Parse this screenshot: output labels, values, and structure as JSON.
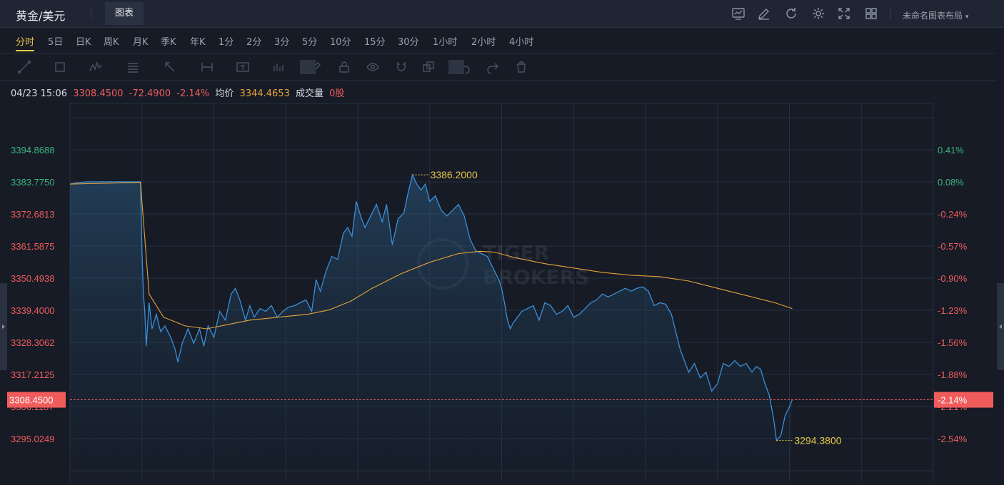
{
  "header": {
    "symbol": "黄金/美元",
    "tab_chart": "图表",
    "layout_name": "未命名图表布局",
    "icons": [
      "chart-type-icon",
      "draw-icon",
      "refresh-icon",
      "settings-icon",
      "fullscreen-icon",
      "layout-grid-icon"
    ]
  },
  "periods": [
    "分时",
    "5日",
    "日K",
    "周K",
    "月K",
    "季K",
    "年K",
    "1分",
    "2分",
    "3分",
    "5分",
    "10分",
    "15分",
    "30分",
    "1小时",
    "2小时",
    "4小时"
  ],
  "active_period": "分时",
  "toolbar": {
    "icons": [
      "line-tool-icon",
      "rect-tool-icon",
      "pattern-tool-icon",
      "fib-tool-icon",
      "arrow-tool-icon",
      "measure-tool-icon",
      "text-tool-icon",
      "volume-tool-icon",
      "pen-icon",
      "lock-icon",
      "eye-icon",
      "magnet-icon",
      "clone-icon",
      "undo-icon",
      "redo-icon",
      "trash-icon"
    ]
  },
  "info": {
    "datetime": "04/23 15:06",
    "price": "3308.4500",
    "change": "-72.4900",
    "change_pct": "-2.14%",
    "avg_label": "均价",
    "avg_value": "3344.4653",
    "volume_label": "成交量",
    "volume_value": "0股"
  },
  "colors": {
    "up": "#3fb37f",
    "down": "#f05c5c",
    "price_line": "#3a8fd9",
    "avg_line": "#e8a23a",
    "highlight": "#e8c547",
    "grid": "#273040",
    "badge_bg": "#f05c5c"
  },
  "chart_data": {
    "type": "line",
    "y_left_ticks": [
      "3394.8688",
      "3383.7750",
      "3372.6813",
      "3361.5875",
      "3350.4938",
      "3339.4000",
      "3328.3062",
      "3317.2125",
      "3306.1187",
      "3295.0249"
    ],
    "y_right_ticks": [
      "0.41%",
      "0.08%",
      "-0.24%",
      "-0.57%",
      "-0.90%",
      "-1.23%",
      "-1.56%",
      "-1.88%",
      "-2.21%",
      "-2.54%"
    ],
    "ylim": [
      3286.7,
      3397.1
    ],
    "prev_close": 3380.94,
    "current_price": 3308.45,
    "current_price_label": "3308.4500",
    "current_pct_label": "-2.14%",
    "high": 3386.2,
    "high_label": "3386.2000",
    "low": 3294.38,
    "low_label": "3294.3800",
    "x_range": [
      0,
      300
    ],
    "price_series": [
      [
        0,
        3383.0
      ],
      [
        5,
        3383.5
      ],
      [
        12,
        3383.8
      ],
      [
        25,
        3383.8
      ],
      [
        49,
        3383.8
      ],
      [
        50,
        3360.0
      ],
      [
        51,
        3345.0
      ],
      [
        52,
        3339.0
      ],
      [
        53,
        3327.0
      ],
      [
        55,
        3342.0
      ],
      [
        57,
        3333.0
      ],
      [
        60,
        3338.0
      ],
      [
        63,
        3332.0
      ],
      [
        66,
        3334.0
      ],
      [
        70,
        3330.0
      ],
      [
        73,
        3326.0
      ],
      [
        75,
        3321.5
      ],
      [
        78,
        3328.0
      ],
      [
        82,
        3333.0
      ],
      [
        86,
        3328.0
      ],
      [
        90,
        3333.0
      ],
      [
        93,
        3327.0
      ],
      [
        96,
        3334.0
      ],
      [
        100,
        3330.0
      ],
      [
        104,
        3339.0
      ],
      [
        108,
        3336.0
      ],
      [
        112,
        3345.0
      ],
      [
        115,
        3347.0
      ],
      [
        118,
        3343.0
      ],
      [
        122,
        3336.0
      ],
      [
        125,
        3341.0
      ],
      [
        128,
        3337.0
      ],
      [
        132,
        3340.0
      ],
      [
        136,
        3339.0
      ],
      [
        140,
        3341.0
      ],
      [
        144,
        3337.0
      ],
      [
        148,
        3339.0
      ],
      [
        152,
        3340.5
      ],
      [
        156,
        3341.0
      ],
      [
        160,
        3342.0
      ],
      [
        164,
        3343.0
      ],
      [
        168,
        3339.0
      ],
      [
        171,
        3350.0
      ],
      [
        174,
        3346.0
      ],
      [
        178,
        3353.0
      ],
      [
        182,
        3358.0
      ],
      [
        186,
        3357.0
      ],
      [
        190,
        3366.0
      ],
      [
        193,
        3368.0
      ],
      [
        196,
        3365.0
      ],
      [
        199,
        3377.0
      ],
      [
        202,
        3372.0
      ],
      [
        205,
        3368.0
      ],
      [
        209,
        3372.0
      ],
      [
        213,
        3376.0
      ],
      [
        217,
        3370.0
      ],
      [
        220,
        3376.0
      ],
      [
        224,
        3362.0
      ],
      [
        228,
        3371.0
      ],
      [
        232,
        3373.0
      ],
      [
        235,
        3380.0
      ],
      [
        238,
        3386.2
      ],
      [
        241,
        3383.0
      ],
      [
        244,
        3381.0
      ],
      [
        247,
        3383.0
      ],
      [
        250,
        3377.0
      ],
      [
        254,
        3379.0
      ],
      [
        258,
        3374.0
      ],
      [
        262,
        3372.0
      ],
      [
        266,
        3374.0
      ],
      [
        270,
        3376.0
      ],
      [
        274,
        3372.0
      ],
      [
        278,
        3364.0
      ],
      [
        282,
        3360.0
      ],
      [
        286,
        3359.0
      ],
      [
        290,
        3358.0
      ],
      [
        294,
        3354.0
      ],
      [
        298,
        3350.0
      ]
    ],
    "price_series_b": [
      [
        300,
        3347.0
      ],
      [
        302,
        3342.0
      ],
      [
        304,
        3336.0
      ],
      [
        306,
        3333.0
      ],
      [
        308,
        3335.0
      ],
      [
        311,
        3337.0
      ],
      [
        314,
        3339.0
      ],
      [
        318,
        3340.0
      ],
      [
        322,
        3341.0
      ],
      [
        326,
        3336.0
      ],
      [
        330,
        3342.0
      ],
      [
        334,
        3341.0
      ],
      [
        338,
        3338.0
      ],
      [
        342,
        3339.0
      ],
      [
        346,
        3341.0
      ],
      [
        350,
        3337.0
      ],
      [
        354,
        3338.0
      ],
      [
        358,
        3340.0
      ],
      [
        362,
        3342.0
      ],
      [
        366,
        3343.0
      ],
      [
        370,
        3345.0
      ],
      [
        374,
        3344.0
      ],
      [
        378,
        3345.0
      ],
      [
        382,
        3346.0
      ],
      [
        386,
        3347.0
      ],
      [
        390,
        3346.0
      ],
      [
        394,
        3347.0
      ],
      [
        398,
        3347.5
      ],
      [
        402,
        3346.0
      ],
      [
        406,
        3341.0
      ],
      [
        410,
        3342.0
      ],
      [
        414,
        3341.5
      ],
      [
        418,
        3338.0
      ],
      [
        421,
        3332.0
      ],
      [
        424,
        3326.0
      ],
      [
        427,
        3322.0
      ],
      [
        430,
        3318.0
      ],
      [
        434,
        3321.0
      ],
      [
        438,
        3316.0
      ],
      [
        442,
        3318.0
      ],
      [
        446,
        3311.5
      ],
      [
        450,
        3314.0
      ],
      [
        454,
        3321.0
      ],
      [
        458,
        3320.0
      ],
      [
        462,
        3322.0
      ],
      [
        466,
        3320.0
      ],
      [
        470,
        3321.0
      ],
      [
        474,
        3318.0
      ],
      [
        477,
        3320.0
      ],
      [
        480,
        3319.0
      ],
      [
        483,
        3314.0
      ],
      [
        486,
        3310.0
      ],
      [
        489,
        3302.0
      ],
      [
        491,
        3294.4
      ],
      [
        494,
        3296.0
      ],
      [
        497,
        3303.0
      ],
      [
        500,
        3306.0
      ],
      [
        502,
        3308.45
      ]
    ],
    "avg_series": [
      [
        0,
        3383.0
      ],
      [
        49,
        3383.6
      ],
      [
        55,
        3345.0
      ],
      [
        65,
        3337.0
      ],
      [
        80,
        3334.0
      ],
      [
        95,
        3333.0
      ],
      [
        110,
        3334.5
      ],
      [
        125,
        3336.0
      ],
      [
        145,
        3337.0
      ],
      [
        165,
        3338.0
      ],
      [
        180,
        3339.5
      ],
      [
        195,
        3342.5
      ],
      [
        210,
        3347.0
      ],
      [
        230,
        3352.0
      ],
      [
        250,
        3356.0
      ],
      [
        270,
        3359.0
      ],
      [
        285,
        3359.8
      ],
      [
        295,
        3359.5
      ],
      [
        310,
        3357.5
      ],
      [
        330,
        3355.5
      ],
      [
        350,
        3354.0
      ],
      [
        370,
        3352.5
      ],
      [
        390,
        3351.5
      ],
      [
        410,
        3351.0
      ],
      [
        430,
        3349.5
      ],
      [
        450,
        3347.0
      ],
      [
        470,
        3344.5
      ],
      [
        490,
        3342.0
      ],
      [
        502,
        3340.0
      ]
    ],
    "x_domain": [
      0,
      600
    ],
    "watermark_line1": "TIGER",
    "watermark_line2": "BROKERS"
  }
}
